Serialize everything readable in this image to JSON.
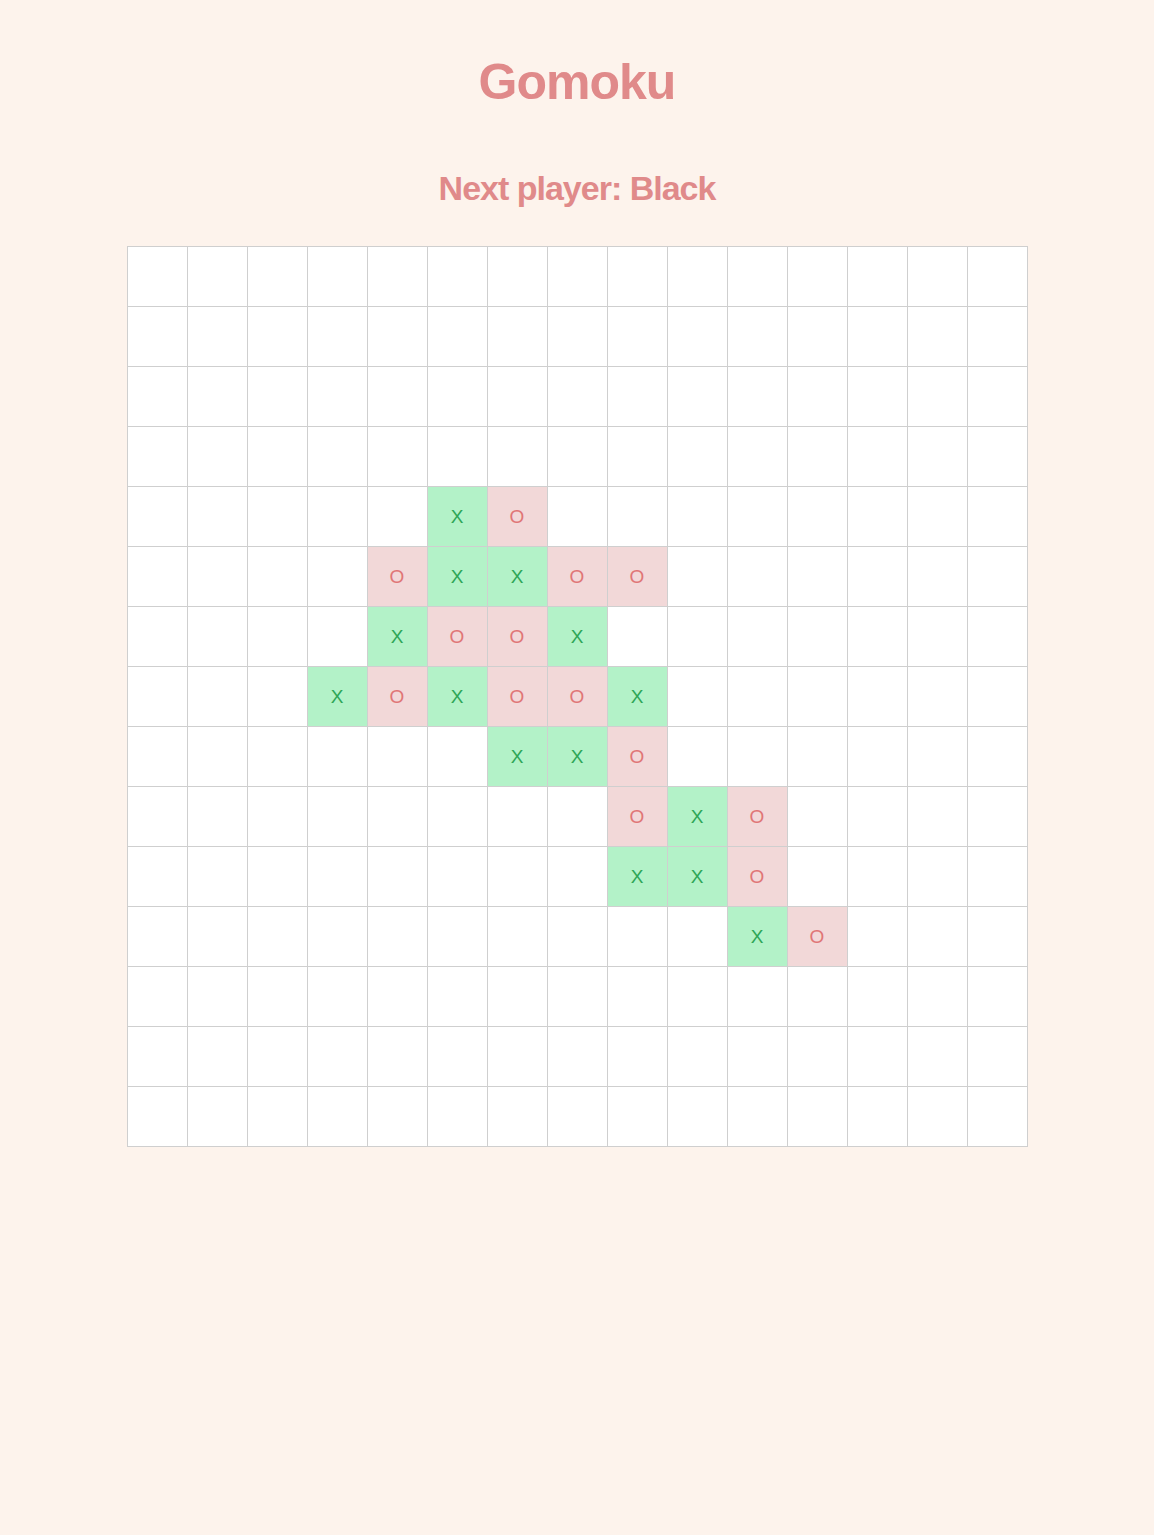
{
  "title": "Gomoku",
  "status": "Next player: Black",
  "board": [
    [
      "",
      "",
      "",
      "",
      "",
      "",
      "",
      "",
      "",
      "",
      "",
      "",
      "",
      "",
      ""
    ],
    [
      "",
      "",
      "",
      "",
      "",
      "",
      "",
      "",
      "",
      "",
      "",
      "",
      "",
      "",
      ""
    ],
    [
      "",
      "",
      "",
      "",
      "",
      "",
      "",
      "",
      "",
      "",
      "",
      "",
      "",
      "",
      ""
    ],
    [
      "",
      "",
      "",
      "",
      "",
      "",
      "",
      "",
      "",
      "",
      "",
      "",
      "",
      "",
      ""
    ],
    [
      "",
      "",
      "",
      "",
      "",
      "X",
      "O",
      "",
      "",
      "",
      "",
      "",
      "",
      "",
      ""
    ],
    [
      "",
      "",
      "",
      "",
      "O",
      "X",
      "X",
      "O",
      "O",
      "",
      "",
      "",
      "",
      "",
      ""
    ],
    [
      "",
      "",
      "",
      "",
      "X",
      "O",
      "O",
      "X",
      "",
      "",
      "",
      "",
      "",
      "",
      ""
    ],
    [
      "",
      "",
      "",
      "X",
      "O",
      "X",
      "O",
      "O",
      "X",
      "",
      "",
      "",
      "",
      "",
      ""
    ],
    [
      "",
      "",
      "",
      "",
      "",
      "",
      "X",
      "X",
      "O",
      "",
      "",
      "",
      "",
      "",
      ""
    ],
    [
      "",
      "",
      "",
      "",
      "",
      "",
      "",
      "",
      "O",
      "X",
      "O",
      "",
      "",
      "",
      ""
    ],
    [
      "",
      "",
      "",
      "",
      "",
      "",
      "",
      "",
      "X",
      "X",
      "O",
      "",
      "",
      "",
      ""
    ],
    [
      "",
      "",
      "",
      "",
      "",
      "",
      "",
      "",
      "",
      "",
      "X",
      "O",
      "",
      "",
      ""
    ],
    [
      "",
      "",
      "",
      "",
      "",
      "",
      "",
      "",
      "",
      "",
      "",
      "",
      "",
      "",
      ""
    ],
    [
      "",
      "",
      "",
      "",
      "",
      "",
      "",
      "",
      "",
      "",
      "",
      "",
      "",
      "",
      ""
    ],
    [
      "",
      "",
      "",
      "",
      "",
      "",
      "",
      "",
      "",
      "",
      "",
      "",
      "",
      "",
      ""
    ]
  ]
}
